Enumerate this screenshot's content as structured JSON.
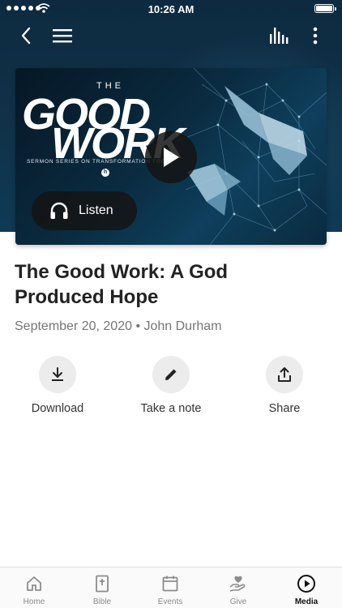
{
  "status_bar": {
    "time": "10:26 AM"
  },
  "top_nav": {
    "back_icon": "chevron-left-icon",
    "menu_icon": "hamburger-menu-icon",
    "audio_icon": "audio-bars-icon",
    "more_icon": "more-vertical-icon"
  },
  "artwork": {
    "overline": "THE",
    "line1": "GOOD",
    "line2": "WORK",
    "series_text": "SERMON SERIES ON TRANSFORMATION FROM",
    "logo_letter": "h"
  },
  "player": {
    "play_icon": "play-icon",
    "listen_label": "Listen",
    "listen_icon": "headphones-icon"
  },
  "sermon": {
    "title": "The Good Work: A God Produced Hope",
    "meta": "September 20, 2020 • John Durham"
  },
  "actions": [
    {
      "label": "Download",
      "icon": "download-icon"
    },
    {
      "label": "Take a note",
      "icon": "pencil-icon"
    },
    {
      "label": "Share",
      "icon": "share-icon"
    }
  ],
  "tabs": [
    {
      "label": "Home",
      "icon": "home-icon",
      "active": false
    },
    {
      "label": "Bible",
      "icon": "bible-icon",
      "active": false
    },
    {
      "label": "Events",
      "icon": "calendar-icon",
      "active": false
    },
    {
      "label": "Give",
      "icon": "give-hand-icon",
      "active": false
    },
    {
      "label": "Media",
      "icon": "play-circle-icon",
      "active": true
    }
  ],
  "colors": {
    "header_bg": "#103249",
    "active_tab": "#111111",
    "inactive_tab": "#8c8c8c",
    "action_circle": "#ececec"
  }
}
